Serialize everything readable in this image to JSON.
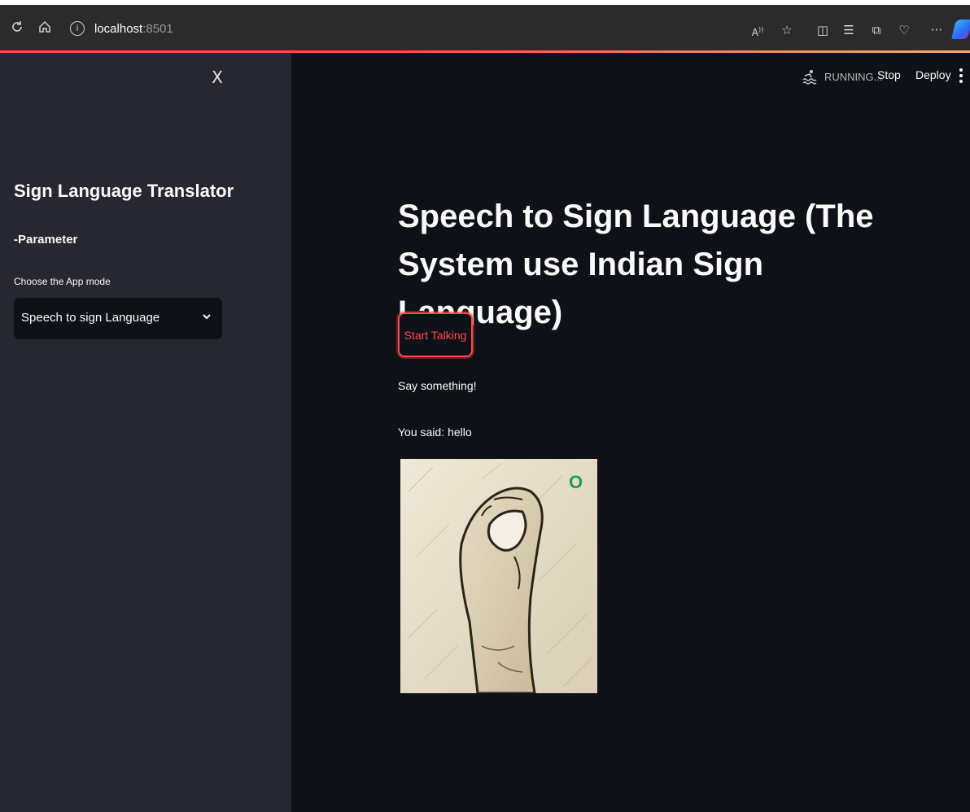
{
  "browser": {
    "url_host": "localhost",
    "url_port": ":8501",
    "icons": [
      "refresh-icon",
      "home-icon",
      "info-icon",
      "read-aloud-icon",
      "favorite-icon",
      "split-screen-icon",
      "favorites-list-icon",
      "collections-icon",
      "health-icon",
      "more-icon",
      "copilot-icon"
    ]
  },
  "sidebar": {
    "close_label": "X",
    "title": "Sign Language Translator",
    "section": "-Parameter",
    "select_label": "Choose the App mode",
    "select_value": "Speech to sign Language"
  },
  "header": {
    "status": "RUNNING...",
    "stop_label": "Stop",
    "deploy_label": "Deploy"
  },
  "main": {
    "title": "Speech to Sign Language (The System use Indian Sign Language)",
    "button_label": "Start Talking",
    "prompt_text": "Say something!",
    "said_prefix": "You said:",
    "said_value": "hello",
    "sign_letter": "O"
  },
  "colors": {
    "accent": "#ff4b4b",
    "background": "#0e1117",
    "sidebar": "#262730",
    "letter": "#1e9e4c"
  }
}
